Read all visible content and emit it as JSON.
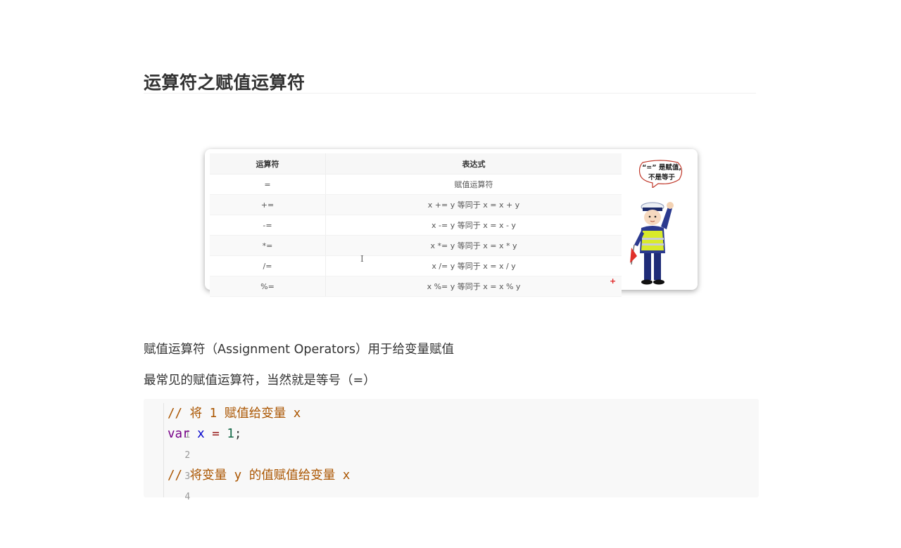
{
  "page_title": "运算符之赋值运算符",
  "figure": {
    "table": {
      "headers": [
        "运算符",
        "表达式"
      ],
      "rows": [
        [
          "=",
          "赋值运算符"
        ],
        [
          "+=",
          "x += y 等同于 x = x + y"
        ],
        [
          "-=",
          "x -= y 等同于 x = x - y"
        ],
        [
          "*=",
          "x *= y 等同于 x = x * y"
        ],
        [
          "/=",
          "x /= y 等同于 x = x / y"
        ],
        [
          "%=",
          "x %= y 等同于 x = x % y"
        ]
      ]
    },
    "bubble_line1": "“=” 是赋值,",
    "bubble_line2": "不是等于",
    "cursor_glyph": "I",
    "plus_mark": "+"
  },
  "paragraphs": {
    "p1": "赋值运算符（Assignment Operators）用于给变量赋值",
    "p2": "最常见的赋值运算符，当然就是等号（=）"
  },
  "code": {
    "lines": [
      {
        "no": "1",
        "comment": "// 将 1 赋值给变量 x"
      },
      {
        "no": "2",
        "kw": "var",
        "var": "x",
        "op": "=",
        "num": "1",
        "end": ";"
      },
      {
        "no": "3"
      },
      {
        "no": "4",
        "comment": "// 将变量 y 的值赋值给变量 x"
      }
    ]
  }
}
